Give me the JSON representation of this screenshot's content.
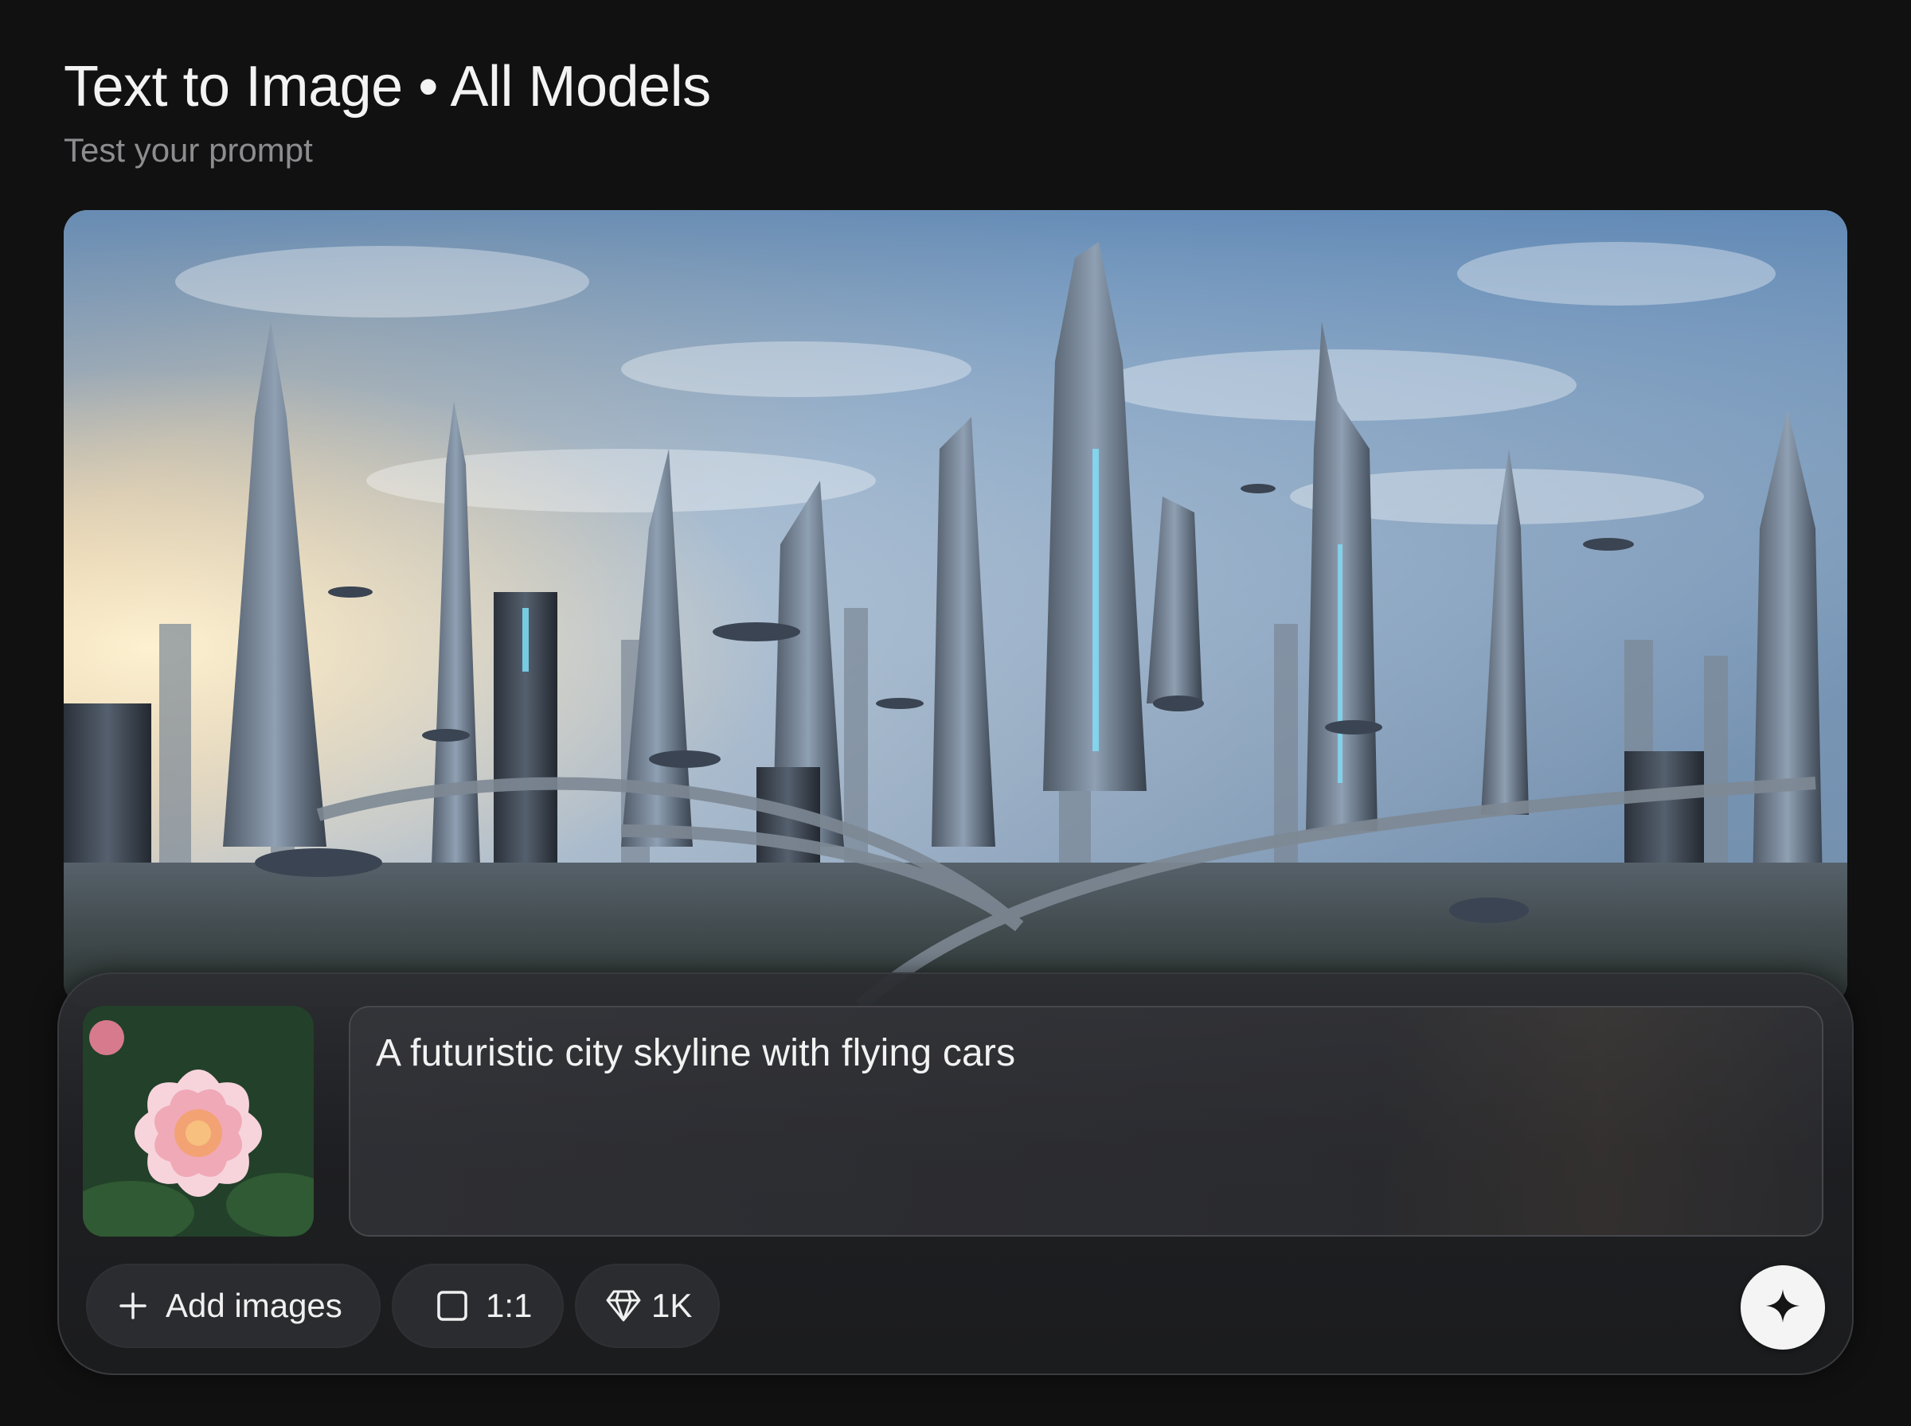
{
  "header": {
    "title": "Text to Image • All Models",
    "subtitle": "Test your prompt"
  },
  "hero_image": {
    "description_icon": "generated-image"
  },
  "composer": {
    "reference_image_icon": "flower-thumbnail",
    "prompt_text": "A futuristic city skyline with flying cars",
    "add_images_label": "Add images",
    "aspect_ratio_label": "1:1",
    "resolution_label": "1K",
    "icons": {
      "add": "plus-icon",
      "ratio": "square-icon",
      "resolution": "diamond-icon",
      "generate": "sparkle-icon"
    }
  }
}
